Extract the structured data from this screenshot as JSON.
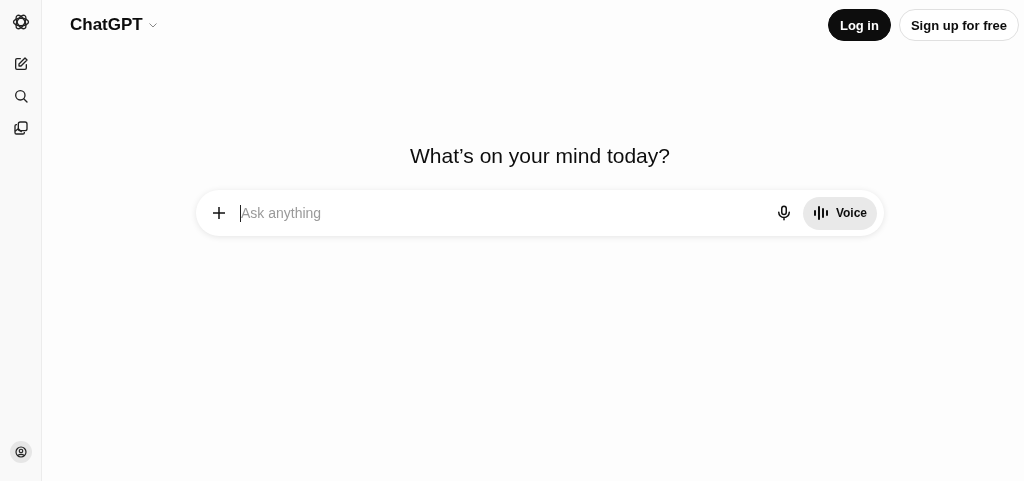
{
  "header": {
    "title": "ChatGPT",
    "buttons": [
      {
        "label": "Log in",
        "kind": "primary"
      },
      {
        "label": "Sign up for free",
        "kind": "secondary"
      }
    ]
  },
  "heading": "What’s on your mind today?",
  "composer": {
    "placeholder": "Ask anything",
    "voice_label": "Voice"
  }
}
